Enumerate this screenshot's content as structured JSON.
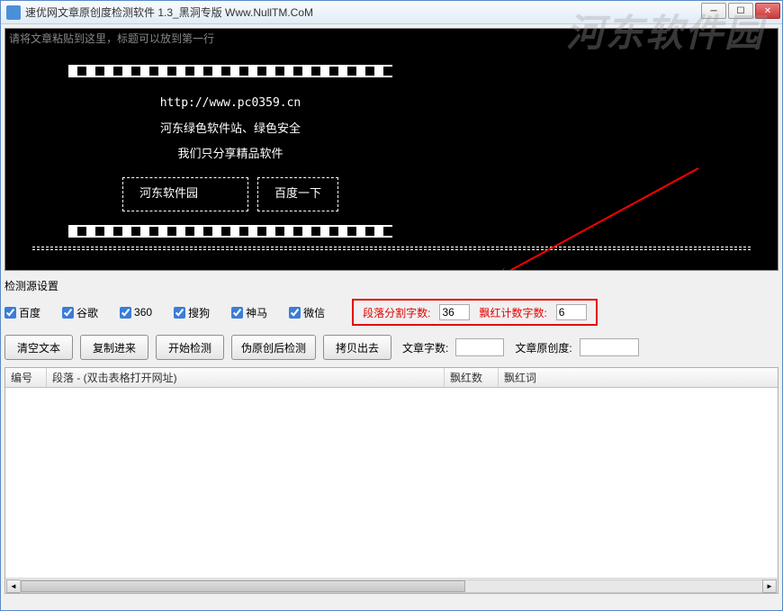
{
  "titlebar": {
    "title": "速优网文章原创度检测软件 1.3_黑洞专版 Www.NullTM.CoM"
  },
  "editor": {
    "placeholder": "请将文章粘贴到这里，标题可以放到第一行",
    "url_line": "http://www.pc0359.cn",
    "line1": "河东绿色软件站、绿色安全",
    "line2": "我们只分享精品软件",
    "btn1": "河东软件园",
    "btn2": "百度一下"
  },
  "sources": {
    "label": "检测源设置",
    "items": [
      {
        "label": "百度",
        "checked": true
      },
      {
        "label": "谷歌",
        "checked": true
      },
      {
        "label": "360",
        "checked": true
      },
      {
        "label": "搜狗",
        "checked": true
      },
      {
        "label": "神马",
        "checked": true
      },
      {
        "label": "微信",
        "checked": true
      }
    ],
    "seg_label": "段落分割字数:",
    "seg_value": "36",
    "red_label": "飘红计数字数:",
    "red_value": "6"
  },
  "buttons": {
    "clear": "清空文本",
    "copy_in": "复制进来",
    "start": "开始检测",
    "fake": "伪原创后检测",
    "copy_out": "拷贝出去"
  },
  "stats": {
    "word_count_label": "文章字数:",
    "word_count_value": "",
    "originality_label": "文章原创度:",
    "originality_value": ""
  },
  "table": {
    "col1": "编号",
    "col2": "段落 - (双击表格打开网址)",
    "col3": "飘红数",
    "col4": "飘红词"
  },
  "watermark": "河东软件园"
}
